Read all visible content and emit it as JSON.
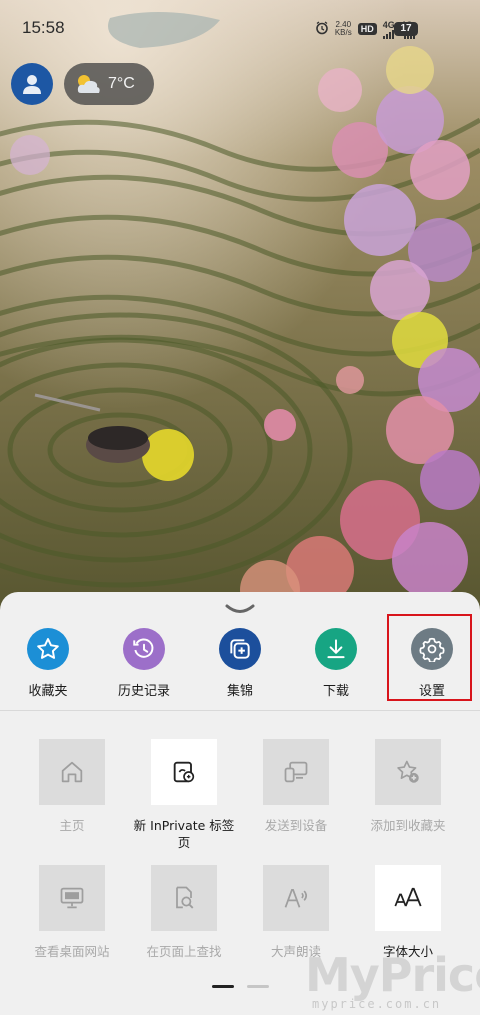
{
  "status_bar": {
    "time": "15:58",
    "net_speed_value": "2.40",
    "net_speed_unit": "KB/s",
    "hd_badge": "HD",
    "sim1": "4G",
    "sim2": "4G+",
    "battery": "17"
  },
  "weather": {
    "temperature": "7°C"
  },
  "quick_actions": [
    {
      "label": "收藏夹",
      "icon": "star-icon",
      "color": "#1c8fd6"
    },
    {
      "label": "历史记录",
      "icon": "history-icon",
      "color": "#9c6fc9"
    },
    {
      "label": "集锦",
      "icon": "collections-icon",
      "color": "#1c4f9c"
    },
    {
      "label": "下载",
      "icon": "download-icon",
      "color": "#17a583"
    },
    {
      "label": "设置",
      "icon": "gear-icon",
      "color": "#6d7b84"
    }
  ],
  "menu_grid": [
    {
      "label": "主页",
      "icon": "home-icon",
      "enabled": false
    },
    {
      "label": "新 InPrivate 标签页",
      "icon": "inprivate-tab-icon",
      "enabled": true
    },
    {
      "label": "发送到设备",
      "icon": "send-to-device-icon",
      "enabled": false
    },
    {
      "label": "添加到收藏夹",
      "icon": "add-favorite-icon",
      "enabled": false
    },
    {
      "label": "查看桌面网站",
      "icon": "desktop-site-icon",
      "enabled": false
    },
    {
      "label": "在页面上查找",
      "icon": "find-in-page-icon",
      "enabled": false
    },
    {
      "label": "大声朗读",
      "icon": "read-aloud-icon",
      "enabled": false
    },
    {
      "label": "字体大小",
      "icon": "font-size-icon",
      "enabled": true
    }
  ],
  "watermark": {
    "brand": "MyPrice",
    "url": "myprice.com.cn"
  },
  "colors": {
    "highlight": "#d8141b",
    "sheet": "#f0f0f0",
    "tile_disabled": "#dcdcdc"
  }
}
